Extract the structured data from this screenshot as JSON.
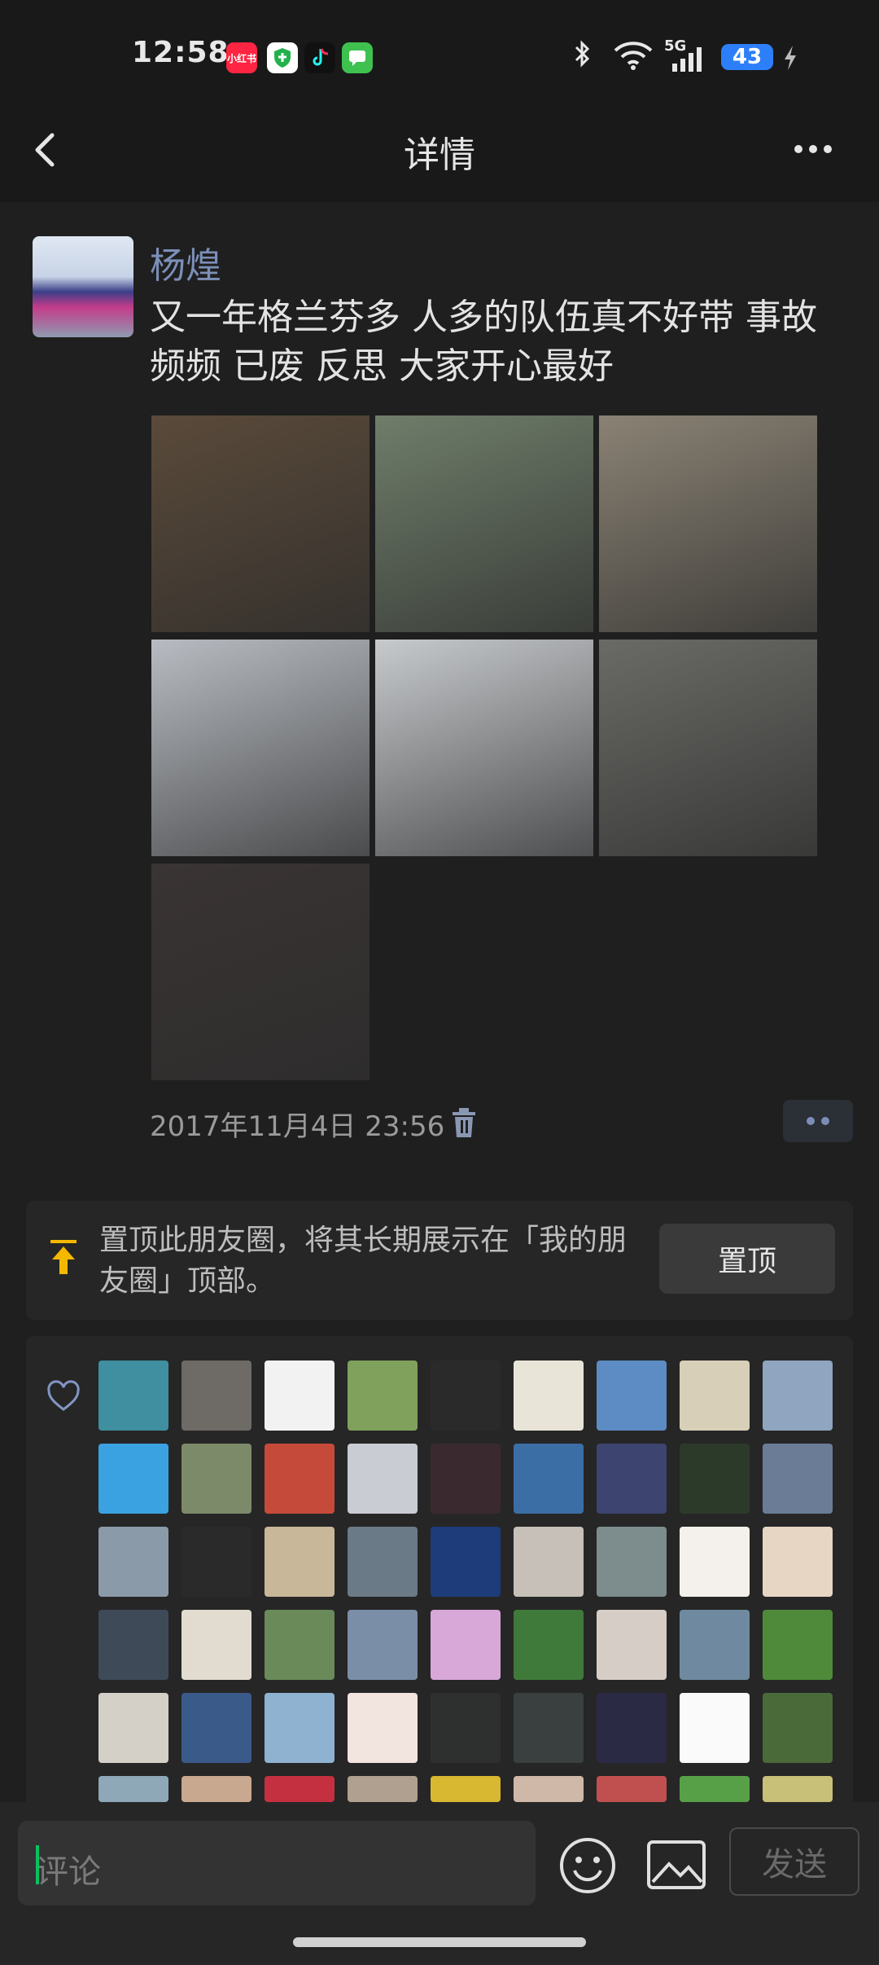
{
  "status_bar": {
    "time": "12:58",
    "network": "5G",
    "battery": "43",
    "apps": [
      {
        "name": "小红书",
        "color": "#ff2442"
      },
      {
        "name": "shield",
        "color": "#22b14c"
      },
      {
        "name": "douyin",
        "color": "#111111"
      },
      {
        "name": "messages",
        "color": "#3fc150"
      }
    ]
  },
  "nav": {
    "title": "详情"
  },
  "post": {
    "username": "杨煌",
    "text": "又一年格兰芬多 人多的队伍真不好带 事故频频 已废 反思 大家开心最好",
    "timestamp": "2017年11月4日 23:56",
    "photos": [
      {
        "name": "dinner-table-group",
        "color": "#5a4a3a"
      },
      {
        "name": "cycling-selfie",
        "color": "#6f7d6a"
      },
      {
        "name": "seagulls-sunset",
        "color": "#8a8274"
      },
      {
        "name": "seagulls-feeding",
        "color": "#b8bcc2"
      },
      {
        "name": "seagulls-flying",
        "color": "#c7cacd"
      },
      {
        "name": "cyclists-lakeside",
        "color": "#6a6a66"
      },
      {
        "name": "two-women-selfie",
        "color": "#3a3434"
      }
    ]
  },
  "pin": {
    "text": "置顶此朋友圈，将其长期展示在「我的朋友圈」顶部。",
    "button": "置顶"
  },
  "likes": {
    "avatars": [
      "#3f8fa0",
      "#6e6a66",
      "#f2f2f2",
      "#7fa15c",
      "#2a2a2a",
      "#e9e4d8",
      "#5d8cc4",
      "#d8cfb8",
      "#8fa5c0",
      "#3aa2e0",
      "#7d8a6a",
      "#c64a3a",
      "#c9ccd2",
      "#3a2a30",
      "#3c6ea6",
      "#3d4470",
      "#2c3a2a",
      "#6b7d96",
      "#8a9aa8",
      "#2a2a2a",
      "#c9b79a",
      "#6a7a86",
      "#1e3c7a",
      "#c7c0b8",
      "#7d8c8c",
      "#f4f1ec",
      "#e7d6c4",
      "#3e4a58",
      "#e2dcd0",
      "#6a8a5a",
      "#7a8ea8",
      "#d7a8d8",
      "#3f7a3a",
      "#d6cec6",
      "#6f8aa0",
      "#4e8a3a",
      "#d4d0c8",
      "#3a5a8a",
      "#8fb2d0",
      "#f2e4de",
      "#2e3030",
      "#3a4040",
      "#2a2a44",
      "#fafafa",
      "#4a6a3a",
      "#8fa8b8",
      "#c9a890",
      "#c43040",
      "#b0a090",
      "#d8b830",
      "#d0b8a8",
      "#c05050",
      "#58a048",
      "#c8c078"
    ]
  },
  "comment": {
    "placeholder": "评论",
    "send": "发送"
  }
}
